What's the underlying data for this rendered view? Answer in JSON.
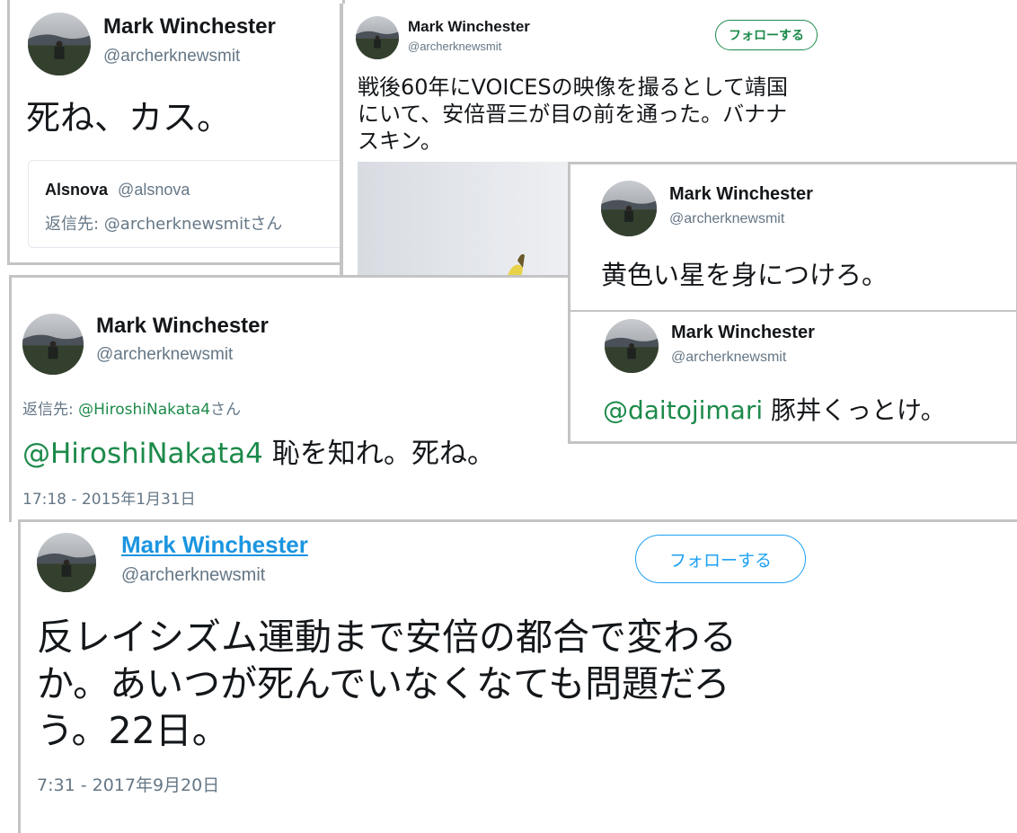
{
  "colors": {
    "mention": "#1c8a4a",
    "link": "#1da1f2",
    "muted": "#657786",
    "border": "#c4c4c4"
  },
  "avatar_icon": "profile-photo-lakeside",
  "tweet1": {
    "name": "Mark Winchester",
    "handle": "@archerknewsmit",
    "text": "死ね、カス。",
    "quote": {
      "name": "Alsnova",
      "handle": "@alsnova",
      "reply_prefix": "返信先: ",
      "reply_to": "@archerknewsmitさん"
    }
  },
  "tweet2": {
    "name": "Mark Winchester",
    "handle": "@archerknewsmit",
    "follow_label": "フォローする",
    "text_line1": "戦後60年にVOICESの映像を撮るとして靖国",
    "text_line2": "にいて、安倍晋三が目の前を通った。バナナ",
    "text_line3": "スキン。",
    "image_icon": "banana-peel-photo"
  },
  "tweet3": {
    "name": "Mark Winchester",
    "handle": "@archerknewsmit",
    "reply_prefix": "返信先: ",
    "reply_mention": "@HiroshiNakata4",
    "reply_suffix": "さん",
    "mention": "@HiroshiNakata4",
    "text": " 恥を知れ。死ね。",
    "time": "17:18 - 2015年1月31日"
  },
  "tweet4": {
    "name": "Mark Winchester",
    "handle": "@archerknewsmit",
    "text": "黄色い星を身につけろ。"
  },
  "tweet5": {
    "name": "Mark Winchester",
    "handle": "@archerknewsmit",
    "mention": "@daitojimari",
    "text": " 豚丼くっとけ。"
  },
  "tweet6": {
    "name": "Mark Winchester",
    "handle": "@archerknewsmit",
    "follow_label": "フォローする",
    "text_line1": "反レイシズム運動まで安倍の都合で変わる",
    "text_line2": "か。あいつが死んでいなくなても問題だろ",
    "text_line3": "う。22日。",
    "time": "7:31 - 2017年9月20日"
  }
}
